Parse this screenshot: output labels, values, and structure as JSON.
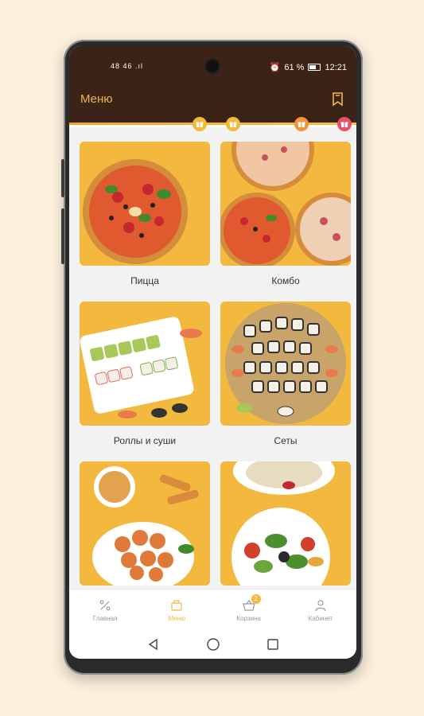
{
  "status_bar": {
    "carrier": "48 46 .ıl",
    "battery": "61 %",
    "time": "12:21"
  },
  "header": {
    "title": "Меню"
  },
  "categories": [
    {
      "label": "Пицца"
    },
    {
      "label": "Комбо"
    },
    {
      "label": "Роллы и суши"
    },
    {
      "label": "Сеты"
    },
    {
      "label": ""
    },
    {
      "label": ""
    }
  ],
  "bottom_nav": {
    "items": [
      {
        "label": "Главная"
      },
      {
        "label": "Меню"
      },
      {
        "label": "Корзина"
      },
      {
        "label": "Кабинет"
      }
    ],
    "cart_badge": "2"
  },
  "colors": {
    "accent": "#f0b648",
    "header_bg": "#3b2417",
    "tile_bg": "#f2b93e"
  }
}
